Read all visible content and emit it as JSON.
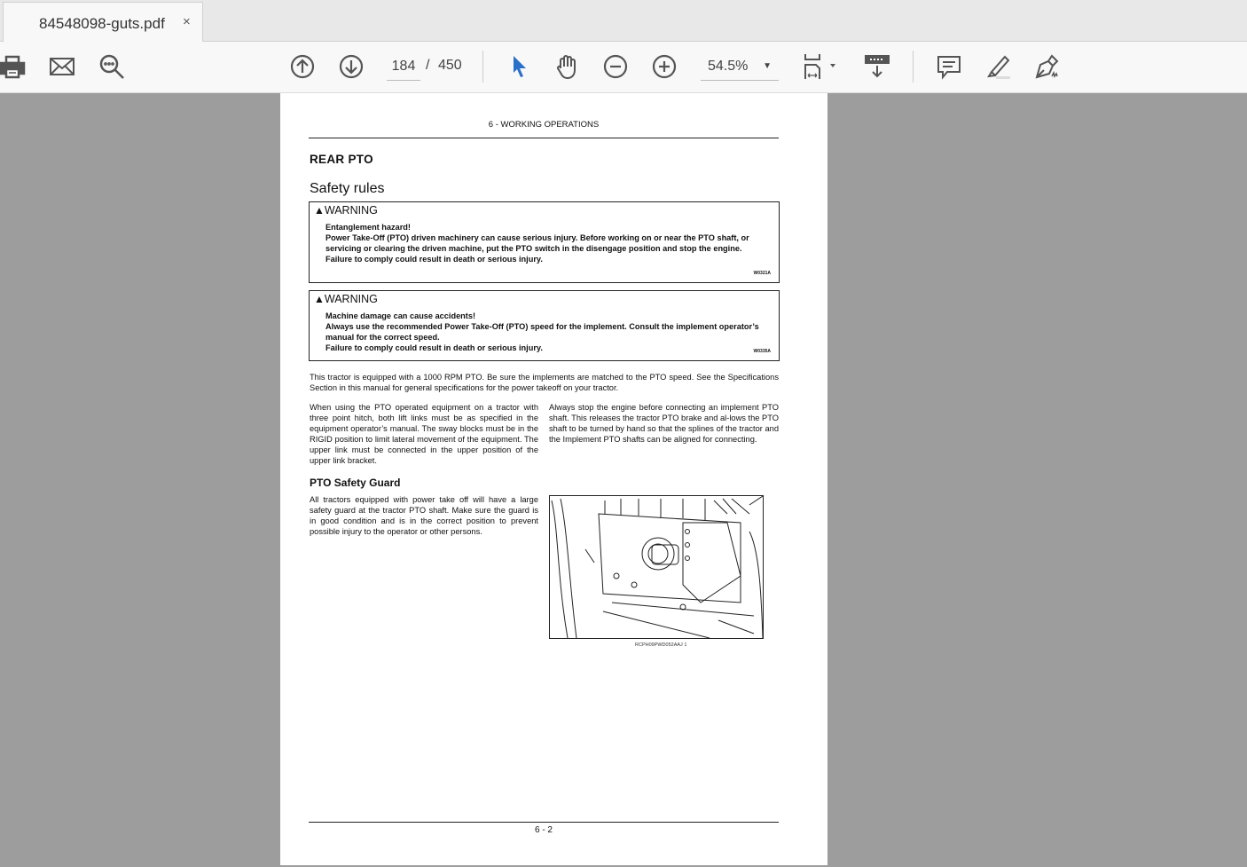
{
  "tab": {
    "title": "84548098-guts.pdf",
    "close": "×"
  },
  "toolbar": {
    "page_current": "184",
    "page_sep": "/",
    "page_total": "450",
    "zoom": "54.5%",
    "zoom_caret": "▼"
  },
  "doc": {
    "header": "6 - WORKING OPERATIONS",
    "title": "REAR PTO",
    "section": "Safety rules",
    "warnings": [
      {
        "label": "WARNING",
        "lines": [
          "Entanglement hazard!",
          "Power Take-Off (PTO) driven machinery can cause serious injury. Before working on or near the PTO shaft, or servicing or clearing the driven machine, put the PTO switch in the disengage position and stop the engine.",
          "Failure to comply could result in death or serious injury."
        ],
        "code": "W0321A"
      },
      {
        "label": "WARNING",
        "lines": [
          "Machine damage can cause accidents!",
          "Always use the recommended Power Take-Off (PTO) speed for the implement. Consult the implement operator’s manual for the correct speed.",
          "Failure to comply could result in death or serious injury."
        ],
        "code": "W0335A"
      }
    ],
    "intro": "This tractor is equipped with a 1000 RPM PTO. Be sure the implements are matched to the PTO speed.  See the Specifications Section in this manual for general specifications for the power takeoff on your tractor.",
    "col_left": "When using the PTO operated equipment on a tractor with three point hitch, both lift links must be as specified in the equipment operator’s manual.  The sway blocks must be in the RIGID position to limit lateral movement of the equipment.  The upper link must be connected in the upper position of the upper link bracket.",
    "col_right": "Always stop the engine before connecting an implement PTO shaft.  This releases the tractor PTO brake and al-lows the PTO shaft to be turned by hand so that the splines of the tractor and the Implement PTO shafts can be aligned for connecting.",
    "guard_title": "PTO Safety Guard",
    "guard_text": "All tractors equipped with power take off will have a large safety guard at the tractor PTO shaft.  Make sure the guard is in good condition and is in the correct position to prevent possible injury to the operator or other persons.",
    "figure_caption": "RCPH09PWD052AAJ    1",
    "footer": "6 - 2"
  }
}
